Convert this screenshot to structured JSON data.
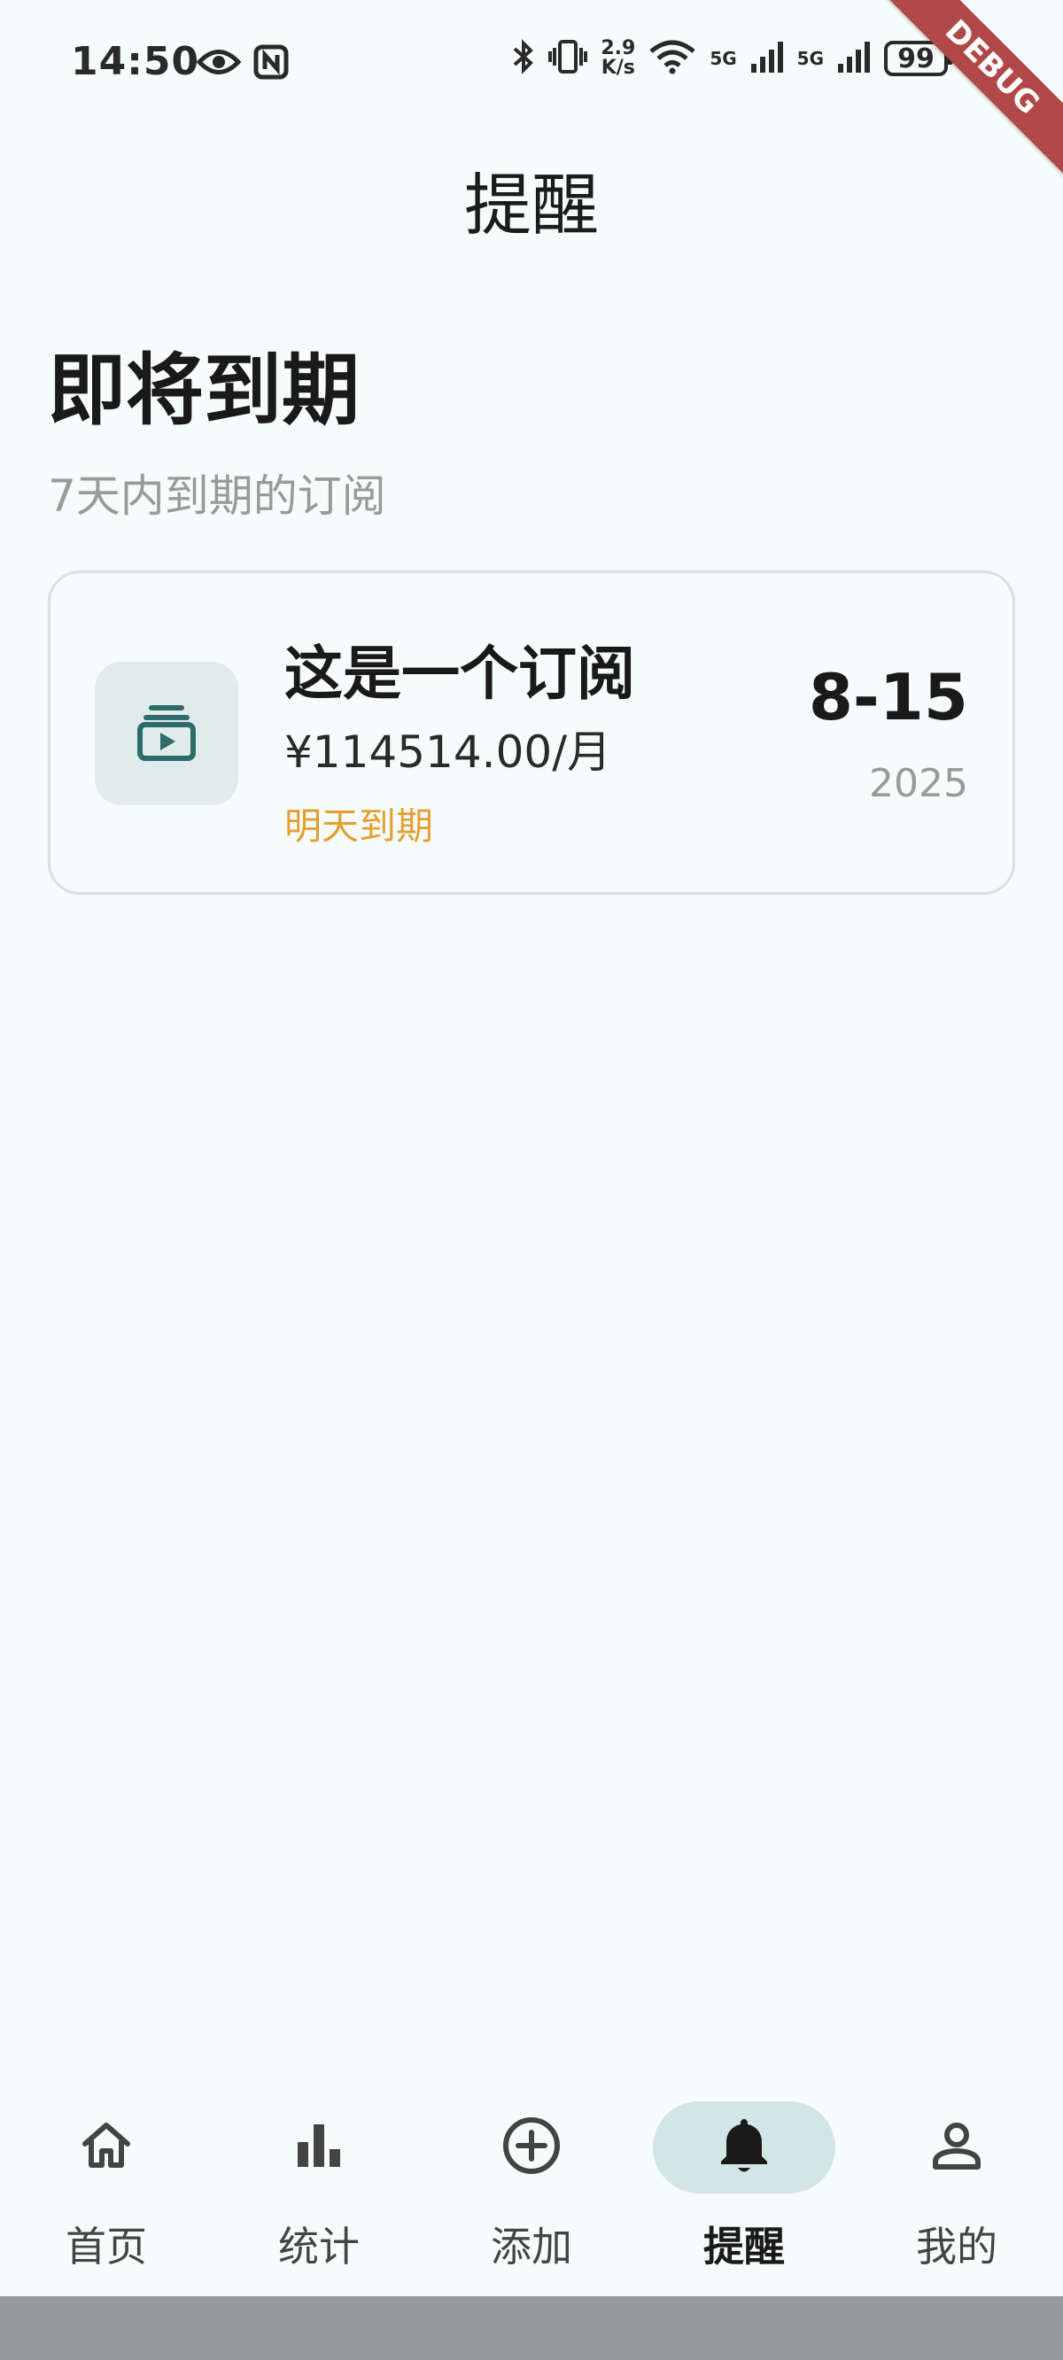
{
  "status_bar": {
    "time": "14:50",
    "speed_value": "2.9",
    "speed_unit": "K/s",
    "net1": "5G",
    "net2": "5G",
    "battery": "99"
  },
  "debug_banner": "DEBUG",
  "page_title": "提醒",
  "section": {
    "title": "即将到期",
    "subtitle": "7天内到期的订阅"
  },
  "subscriptions": [
    {
      "name": "这是一个订阅",
      "price": "¥114514.00/月",
      "due_text": "明天到期",
      "date": "8-15",
      "year": "2025",
      "icon": "subscription-play-icon"
    }
  ],
  "bottom_nav": {
    "items": [
      {
        "label": "首页",
        "icon": "home-icon",
        "active": false
      },
      {
        "label": "统计",
        "icon": "bar-chart-icon",
        "active": false
      },
      {
        "label": "添加",
        "icon": "add-circle-icon",
        "active": false
      },
      {
        "label": "提醒",
        "icon": "bell-icon",
        "active": true
      },
      {
        "label": "我的",
        "icon": "person-icon",
        "active": false
      }
    ]
  },
  "colors": {
    "background": "#f6fcfc",
    "accent": "#2e6b6b",
    "due_warning": "#e3a032",
    "nav_active_bg": "#d2e6e6"
  }
}
